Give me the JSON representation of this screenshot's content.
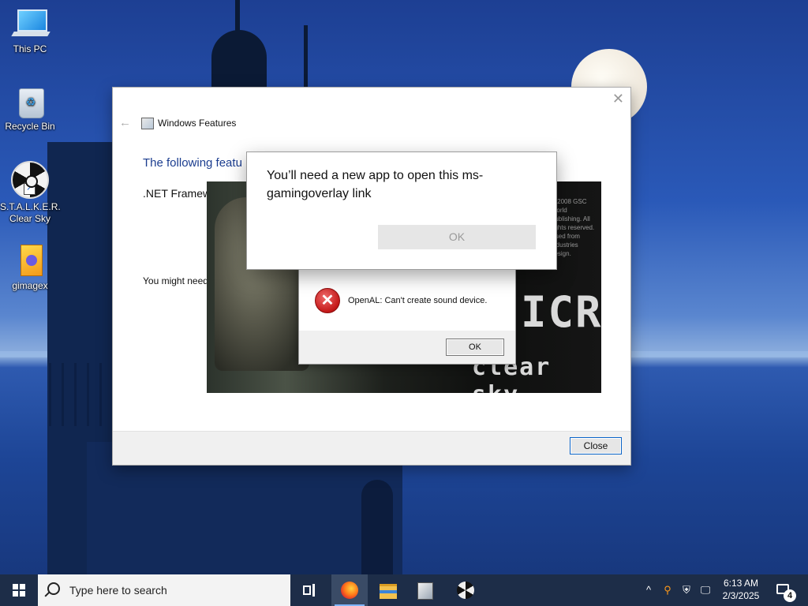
{
  "desktop": {
    "icons": [
      {
        "label": "This PC",
        "icon": "computer-icon"
      },
      {
        "label": "Recycle Bin",
        "icon": "recycle-bin-icon"
      },
      {
        "label": "S.T.A.L.K.E.R. Clear Sky",
        "icon": "radiation-icon"
      },
      {
        "label": "gimagex",
        "icon": "document-icon"
      }
    ]
  },
  "windows_features": {
    "title": "Windows Features",
    "heading": "The following featu",
    "feature": ".NET Framew",
    "note": "You might need",
    "close_label": "Close",
    "close_x": "✕",
    "back_arrow": "←"
  },
  "splash": {
    "fine_print": "© 2008 GSC World Publishing. All rights reserved. Used from Industries design.",
    "logo_text": "ICR",
    "subtitle": "clear sky"
  },
  "openal_dialog": {
    "message": "OpenAL: Can't create sound device.",
    "ok_label": "OK",
    "icon": "error-icon"
  },
  "gamingoverlay_dialog": {
    "message": "You’ll need a new app to open this ms-gamingoverlay link",
    "ok_label": "OK"
  },
  "taskbar": {
    "search_placeholder": "Type here to search",
    "pinned": [
      "task-view-icon",
      "firefox-icon",
      "file-explorer-icon",
      "documents-icon",
      "stalker-icon"
    ],
    "tray": {
      "chevron": "^",
      "time": "6:13 AM",
      "date": "2/3/2025",
      "notification_count": "4"
    }
  },
  "colors": {
    "accent": "#0a64c8",
    "heading_blue": "#1b3d8f",
    "taskbar": "#1d2d48",
    "error_red": "#c41818"
  }
}
